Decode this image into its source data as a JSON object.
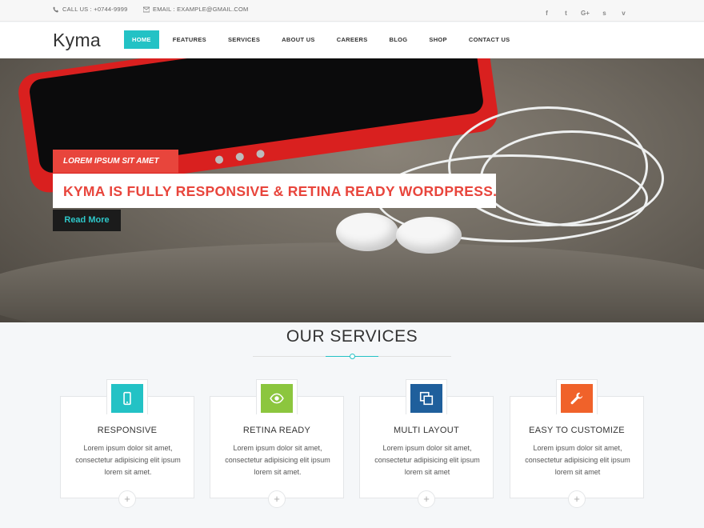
{
  "topbar": {
    "phone_label": "CALL US : +0744-9999",
    "email_label": "EMAIL : EXAMPLE@GMAIL.COM",
    "social": [
      "facebook-icon",
      "twitter-icon",
      "google-plus-icon",
      "skype-icon",
      "vimeo-icon"
    ],
    "social_glyphs": [
      "f",
      "t",
      "G+",
      "s",
      "v"
    ]
  },
  "header": {
    "logo": "Kyma",
    "nav": [
      "HOME",
      "FEATURES",
      "SERVICES",
      "ABOUT US",
      "CAREERS",
      "BLOG",
      "SHOP",
      "CONTACT US"
    ],
    "active_item": "HOME",
    "accent_color": "#23c2c5"
  },
  "hero": {
    "tag": "LOREM IPSUM SIT AMET",
    "headline": "KYMA IS FULLY RESPONSIVE & RETINA READY WORDPRESS...",
    "button": "Read More",
    "tag_color": "#e8453c"
  },
  "services": {
    "title": "OUR SERVICES",
    "cards": [
      {
        "icon": "mobile-icon",
        "color": "#23c2c5",
        "title": "RESPONSIVE",
        "text": "Lorem ipsum dolor sit amet, consectetur adipisicing elit ipsum lorem sit amet."
      },
      {
        "icon": "eye-icon",
        "color": "#8cc63e",
        "title": "RETINA READY",
        "text": "Lorem ipsum dolor sit amet, consectetur adipisicing elit ipsum lorem sit amet."
      },
      {
        "icon": "copy-icon",
        "color": "#1f5f9c",
        "title": "MULTI LAYOUT",
        "text": "Lorem ipsum dolor sit amet, consectetur adipisicing elit ipsum lorem sit amet"
      },
      {
        "icon": "wrench-icon",
        "color": "#f0622a",
        "title": "EASY TO CUSTOMIZE",
        "text": "Lorem ipsum dolor sit amet, consectetur adipisicing elit ipsum lorem sit amet"
      }
    ]
  }
}
